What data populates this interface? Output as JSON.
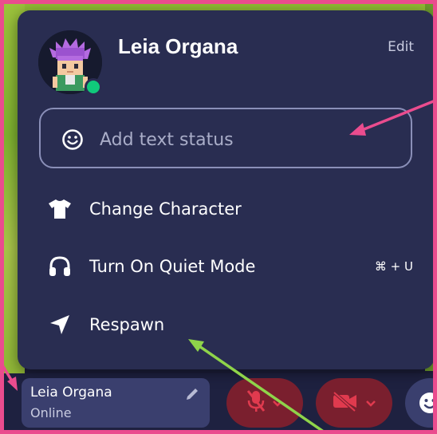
{
  "profile": {
    "name": "Leia Organa",
    "edit_label": "Edit",
    "online_status_color": "#10c97b"
  },
  "status_input": {
    "placeholder": "Add text status",
    "value": "",
    "icon": "smile-icon"
  },
  "menu_items": [
    {
      "label": "Change Character",
      "icon": "shirt-icon",
      "shortcut": ""
    },
    {
      "label": "Turn On Quiet Mode",
      "icon": "headphones-icon",
      "shortcut": "⌘ + U"
    },
    {
      "label": "Respawn",
      "icon": "navigation-arrow-icon",
      "shortcut": ""
    }
  ],
  "bottom_bar": {
    "profile_name": "Leia Organa",
    "profile_status": "Online",
    "mic_state": "muted",
    "camera_state": "off"
  },
  "colors": {
    "menu_bg": "#292d51",
    "annotation_pink": "#ea4c8e",
    "annotation_green": "#8fd44a",
    "muted_red": "#7a1f2e",
    "icon_red": "#e03a4e"
  }
}
